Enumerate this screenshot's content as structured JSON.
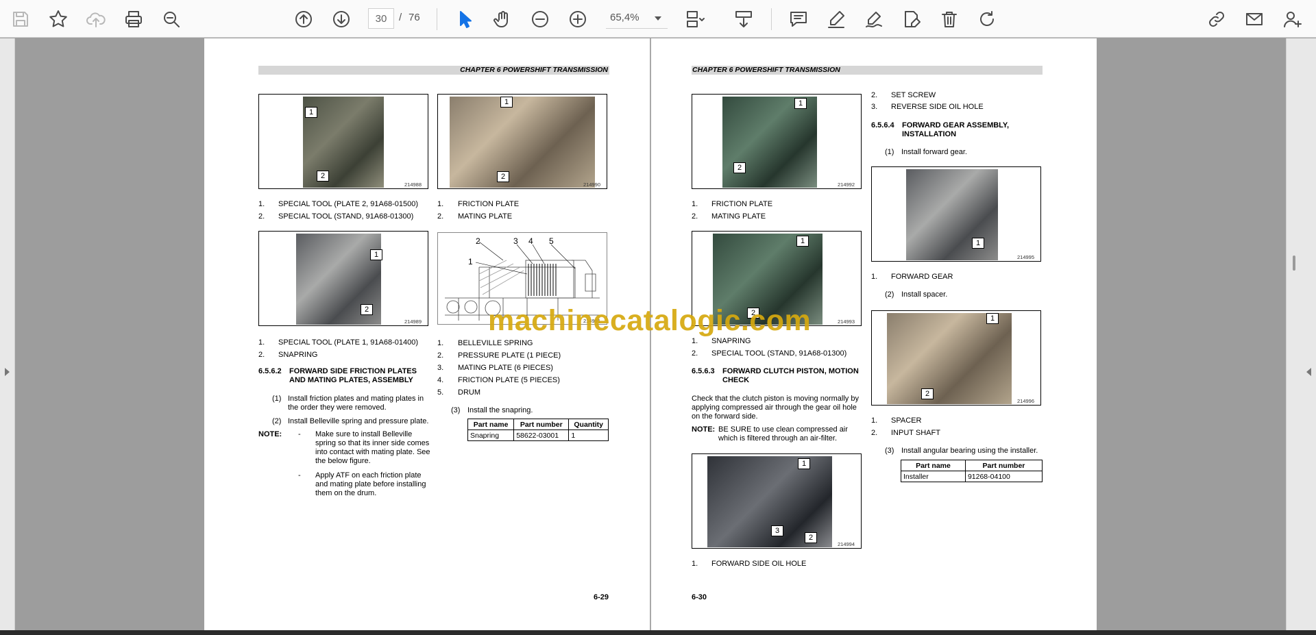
{
  "toolbar": {
    "current_page": "30",
    "page_separator": "/",
    "total_pages": "76",
    "zoom": "65,4%"
  },
  "watermark": "machinecatalogic.com",
  "left_page": {
    "header": "CHAPTER 6 POWERSHIFT TRANSMISSION",
    "fig1": {
      "callouts": [
        "1",
        "2"
      ],
      "id": "214988"
    },
    "fig2": {
      "callouts": [
        "1",
        "2"
      ],
      "id": "214990"
    },
    "fig1_legend": [
      {
        "n": "1.",
        "t": "SPECIAL TOOL (PLATE 2, 91A68-01500)"
      },
      {
        "n": "2.",
        "t": "SPECIAL TOOL (STAND, 91A68-01300)"
      }
    ],
    "fig2_legend": [
      {
        "n": "1.",
        "t": "FRICTION PLATE"
      },
      {
        "n": "2.",
        "t": "MATING PLATE"
      }
    ],
    "fig3": {
      "callouts": [
        "1",
        "2"
      ],
      "id": "214989"
    },
    "fig4": {
      "callouts": [
        "1",
        "2",
        "3",
        "4",
        "5"
      ],
      "id": "214991"
    },
    "fig3_legend": [
      {
        "n": "1.",
        "t": "SPECIAL TOOL (PLATE 1, 91A68-01400)"
      },
      {
        "n": "2.",
        "t": "SNAPRING"
      }
    ],
    "fig4_legend": [
      {
        "n": "1.",
        "t": "BELLEVILLE SPRING"
      },
      {
        "n": "2.",
        "t": "PRESSURE PLATE (1 PIECE)"
      },
      {
        "n": "3.",
        "t": "MATING PLATE (6 PIECES)"
      },
      {
        "n": "4.",
        "t": "FRICTION PLATE (5 PIECES)"
      },
      {
        "n": "5.",
        "t": "DRUM"
      }
    ],
    "section": {
      "num": "6.5.6.2",
      "title_1": "FORWARD SIDE FRICTION PLATES",
      "title_2": "AND MATING PLATES, ASSEMBLY"
    },
    "step1": {
      "n": "(1)",
      "l1": "Install friction plates and mating plates in",
      "l2": "the order they were removed."
    },
    "step2": {
      "n": "(2)",
      "t": "Install Belleville spring and pressure plate."
    },
    "note": {
      "label": "NOTE:",
      "b1": {
        "dash": "-",
        "l1": "Make sure to install Belleville",
        "l2": "spring so that its inner side comes",
        "l3": "into contact with mating plate. See",
        "l4": "the below figure."
      },
      "b2": {
        "dash": "-",
        "l1": "Apply ATF on each friction plate",
        "l2": "and mating plate before installing",
        "l3": "them on the drum."
      }
    },
    "step3": {
      "n": "(3)",
      "t": "Install the snapring."
    },
    "table": {
      "headers": [
        "Part name",
        "Part number",
        "Quantity"
      ],
      "row": [
        "Snapring",
        "58622-03001",
        "1"
      ]
    },
    "page_number": "6-29"
  },
  "right_page": {
    "header": "CHAPTER 6 POWERSHIFT TRANSMISSION",
    "fig1": {
      "callouts": [
        "1",
        "2"
      ],
      "id": "214992"
    },
    "fig1_legend": [
      {
        "n": "1.",
        "t": "FRICTION PLATE"
      },
      {
        "n": "2.",
        "t": "MATING PLATE"
      }
    ],
    "fig2": {
      "callouts": [
        "1",
        "2"
      ],
      "id": "214993"
    },
    "fig2_legend": [
      {
        "n": "1.",
        "t": "SNAPRING"
      },
      {
        "n": "2.",
        "t": "SPECIAL TOOL (STAND, 91A68-01300)"
      }
    ],
    "section3": {
      "num": "6.5.6.3",
      "title_1": "FORWARD CLUTCH PISTON, MOTION",
      "title_2": "CHECK"
    },
    "para": {
      "l1": "Check that the clutch piston is moving normally by",
      "l2": "applying compressed air through the gear oil hole",
      "l3": "on the forward side."
    },
    "note": {
      "label": "NOTE:",
      "l1": "BE SURE to use clean compressed air",
      "l2": "which is filtered through an air-filter."
    },
    "fig3": {
      "callouts": [
        "1",
        "2",
        "3"
      ],
      "id": "214994"
    },
    "fig3_legend": [
      {
        "n": "1.",
        "t": "FORWARD SIDE OIL HOLE"
      }
    ],
    "col2_top": [
      {
        "n": "2.",
        "t": "SET SCREW"
      },
      {
        "n": "3.",
        "t": "REVERSE SIDE OIL HOLE"
      }
    ],
    "section4": {
      "num": "6.5.6.4",
      "title_1": "FORWARD GEAR ASSEMBLY,",
      "title_2": "INSTALLATION"
    },
    "step1": {
      "n": "(1)",
      "t": "Install forward gear."
    },
    "fig4": {
      "callouts": [
        "1"
      ],
      "id": "214995"
    },
    "fig4_legend": [
      {
        "n": "1.",
        "t": "FORWARD GEAR"
      }
    ],
    "step2": {
      "n": "(2)",
      "t": "Install spacer."
    },
    "fig5": {
      "callouts": [
        "1",
        "2"
      ],
      "id": "214996"
    },
    "fig5_legend": [
      {
        "n": "1.",
        "t": "SPACER"
      },
      {
        "n": "2.",
        "t": "INPUT SHAFT"
      }
    ],
    "step3": {
      "n": "(3)",
      "t": "Install angular bearing using the installer."
    },
    "table": {
      "headers": [
        "Part name",
        "Part number"
      ],
      "row": [
        "Installer",
        "91268-04100"
      ]
    },
    "page_number": "6-30"
  }
}
